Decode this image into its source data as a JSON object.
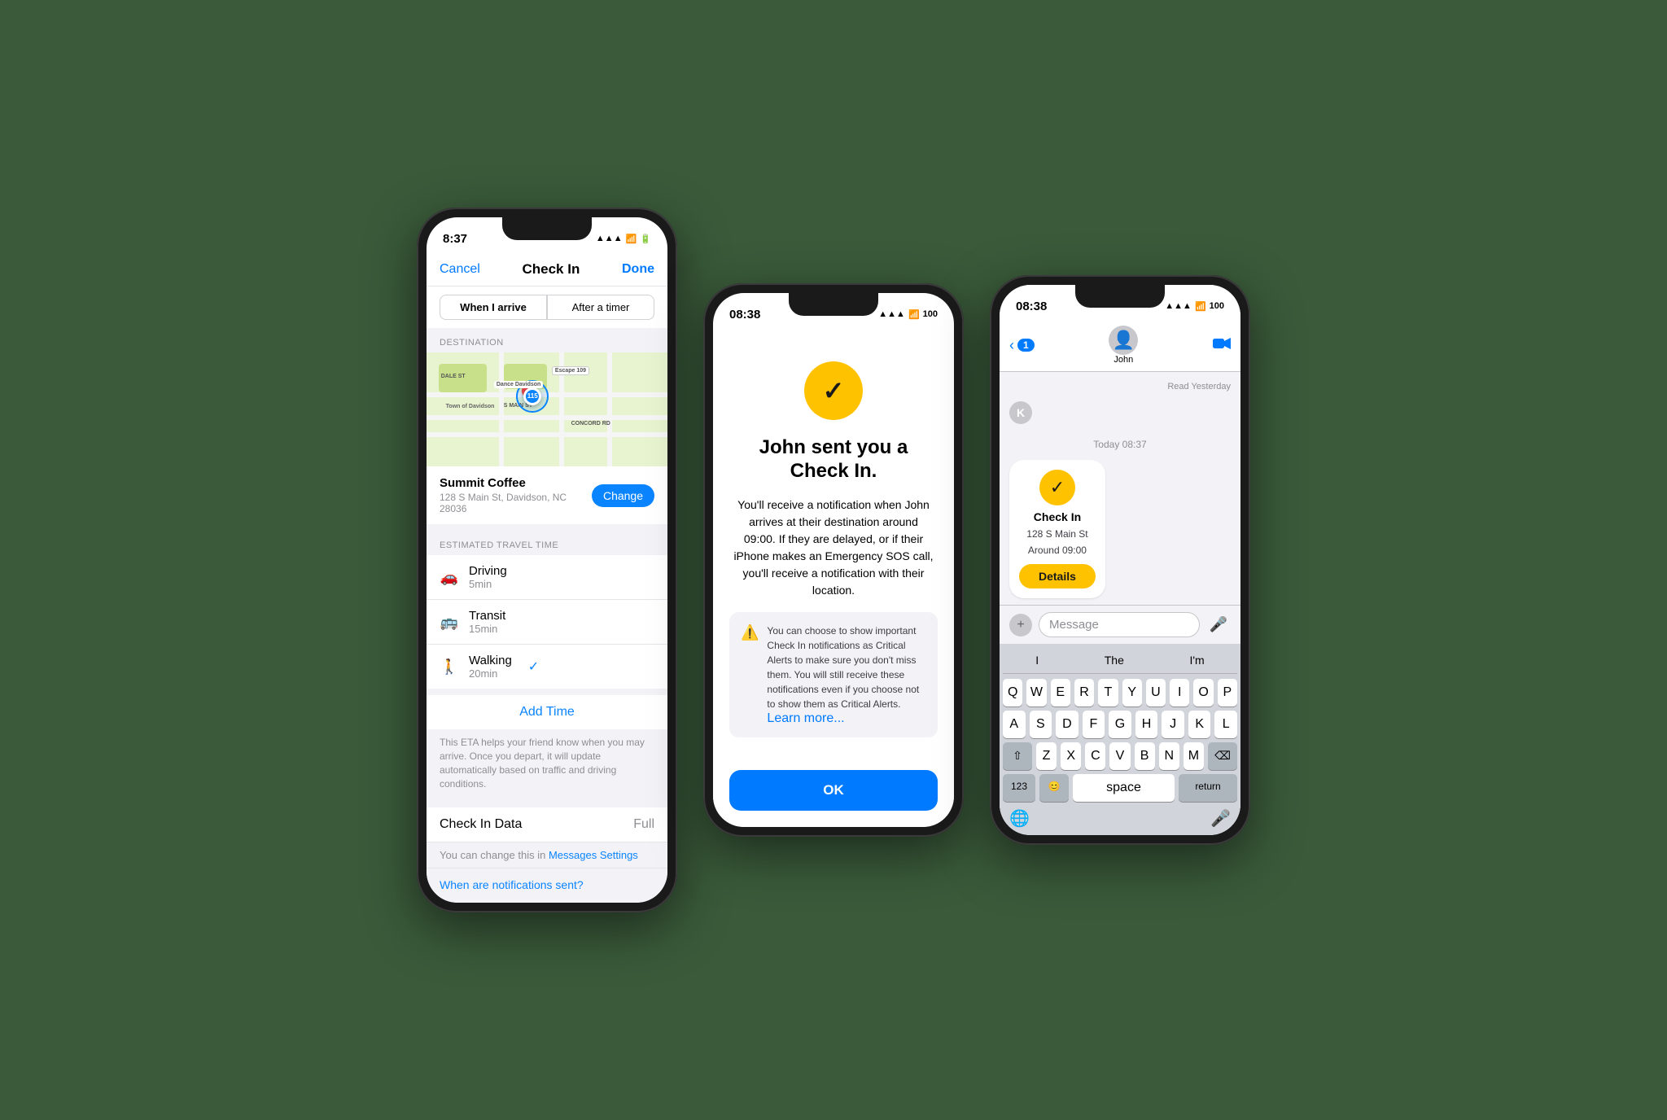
{
  "phone1": {
    "status_time": "8:37",
    "status_signal": "▲▲▲",
    "status_wifi": "wifi",
    "status_battery": "battery",
    "header": {
      "cancel": "Cancel",
      "title": "Check In",
      "done": "Done"
    },
    "segment": {
      "option1": "When I arrive",
      "option2": "After a timer"
    },
    "destination_label": "DESTINATION",
    "destination_name": "Summit Coffee",
    "destination_addr": "128 S Main St, Davidson, NC  28036",
    "change_btn": "Change",
    "travel_label": "ESTIMATED TRAVEL TIME",
    "travel_modes": [
      {
        "icon": "🚗",
        "label": "Driving",
        "time": "5min",
        "checked": false
      },
      {
        "icon": "🚌",
        "label": "Transit",
        "time": "15min",
        "checked": false
      },
      {
        "icon": "🚶",
        "label": "Walking",
        "time": "20min",
        "checked": true
      }
    ],
    "add_time": "Add Time",
    "eta_desc": "This ETA helps your friend know when you may arrive. Once you depart, it will update automatically based on traffic and driving conditions.",
    "checkin_data_label": "Check In Data",
    "checkin_data_value": "Full",
    "settings_text": "You can change this in ",
    "settings_link": "Messages Settings",
    "notifications_link": "When are notifications sent?"
  },
  "phone2": {
    "status_time": "08:38",
    "status_signal": "▲▲▲",
    "status_wifi": "wifi",
    "status_battery": "100",
    "title": "John sent you a Check In.",
    "body": "You'll receive a notification when John arrives at their destination around 09:00. If they are delayed, or if their iPhone makes an Emergency SOS call, you'll receive a notification with their location.",
    "warning_text": "You can choose to show important Check In notifications as Critical Alerts to make sure you don't miss them. You will still receive these notifications even if you choose not to show them as Critical Alerts.",
    "warning_link": "Learn more...",
    "ok_button": "OK"
  },
  "phone3": {
    "status_time": "08:38",
    "status_signal": "▲▲▲",
    "status_wifi": "wifi",
    "status_battery": "100",
    "back_count": "1",
    "contact_name": "John",
    "read_label": "Read Yesterday",
    "timestamp": "Today 08:37",
    "checkin_card": {
      "title": "Check In",
      "address": "128 S Main St",
      "time": "Around 09:00",
      "details_btn": "Details"
    },
    "msg_placeholder": "Message",
    "keyboard": {
      "suggestions": [
        "I",
        "The",
        "I'm"
      ],
      "row1": [
        "Q",
        "W",
        "E",
        "R",
        "T",
        "Y",
        "U",
        "I",
        "O",
        "P"
      ],
      "row2": [
        "A",
        "S",
        "D",
        "F",
        "G",
        "H",
        "J",
        "K",
        "L"
      ],
      "row3": [
        "Z",
        "X",
        "C",
        "V",
        "B",
        "N",
        "M"
      ],
      "shift": "⇧",
      "delete": "⌫",
      "num": "123",
      "emoji": "😊",
      "space": "space",
      "return": "return",
      "globe": "🌐",
      "mic": "🎤"
    }
  }
}
